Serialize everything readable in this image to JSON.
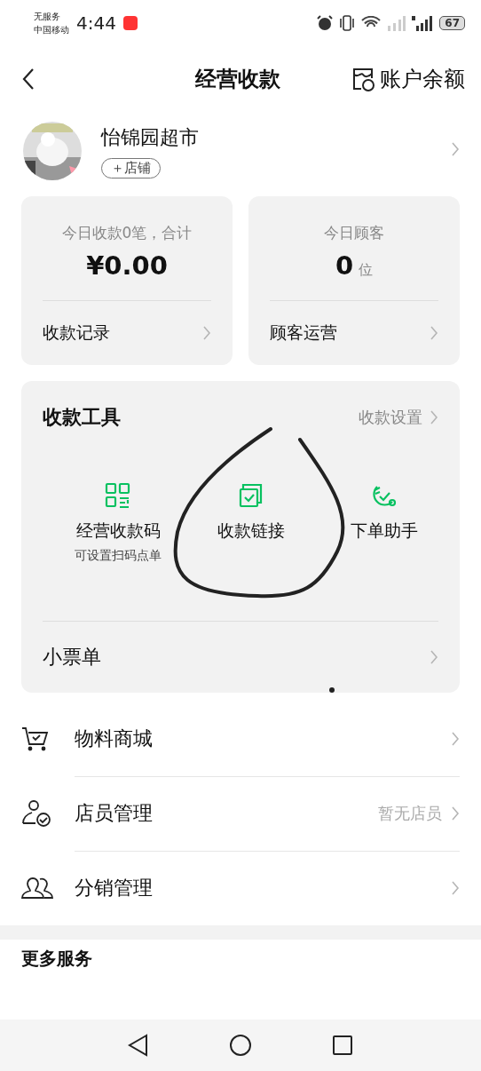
{
  "status_bar": {
    "carrier_status": "无服务",
    "carrier": "中国移动",
    "time": "4:44",
    "battery": "67"
  },
  "header": {
    "title": "经营收款",
    "balance_link": "账户余额"
  },
  "store": {
    "name": "怡锦园超市",
    "tag": "＋店铺"
  },
  "stats": [
    {
      "caption": "今日收款0笔，合计",
      "value": "¥0.00",
      "link": "收款记录"
    },
    {
      "caption": "今日顾客",
      "value": "0",
      "unit": "位",
      "link": "顾客运营"
    }
  ],
  "tools": {
    "title": "收款工具",
    "settings": "收款设置",
    "items": [
      {
        "kind": "qr",
        "label": "经营收款码",
        "sub": "可设置扫码点单"
      },
      {
        "kind": "link",
        "label": "收款链接"
      },
      {
        "kind": "order",
        "label": "下单助手"
      }
    ],
    "receipt": "小票单"
  },
  "menu": [
    {
      "kind": "cart",
      "label": "物料商城"
    },
    {
      "kind": "staff",
      "label": "店员管理",
      "hint": "暂无店员"
    },
    {
      "kind": "group",
      "label": "分销管理"
    }
  ],
  "more": {
    "title": "更多服务"
  }
}
